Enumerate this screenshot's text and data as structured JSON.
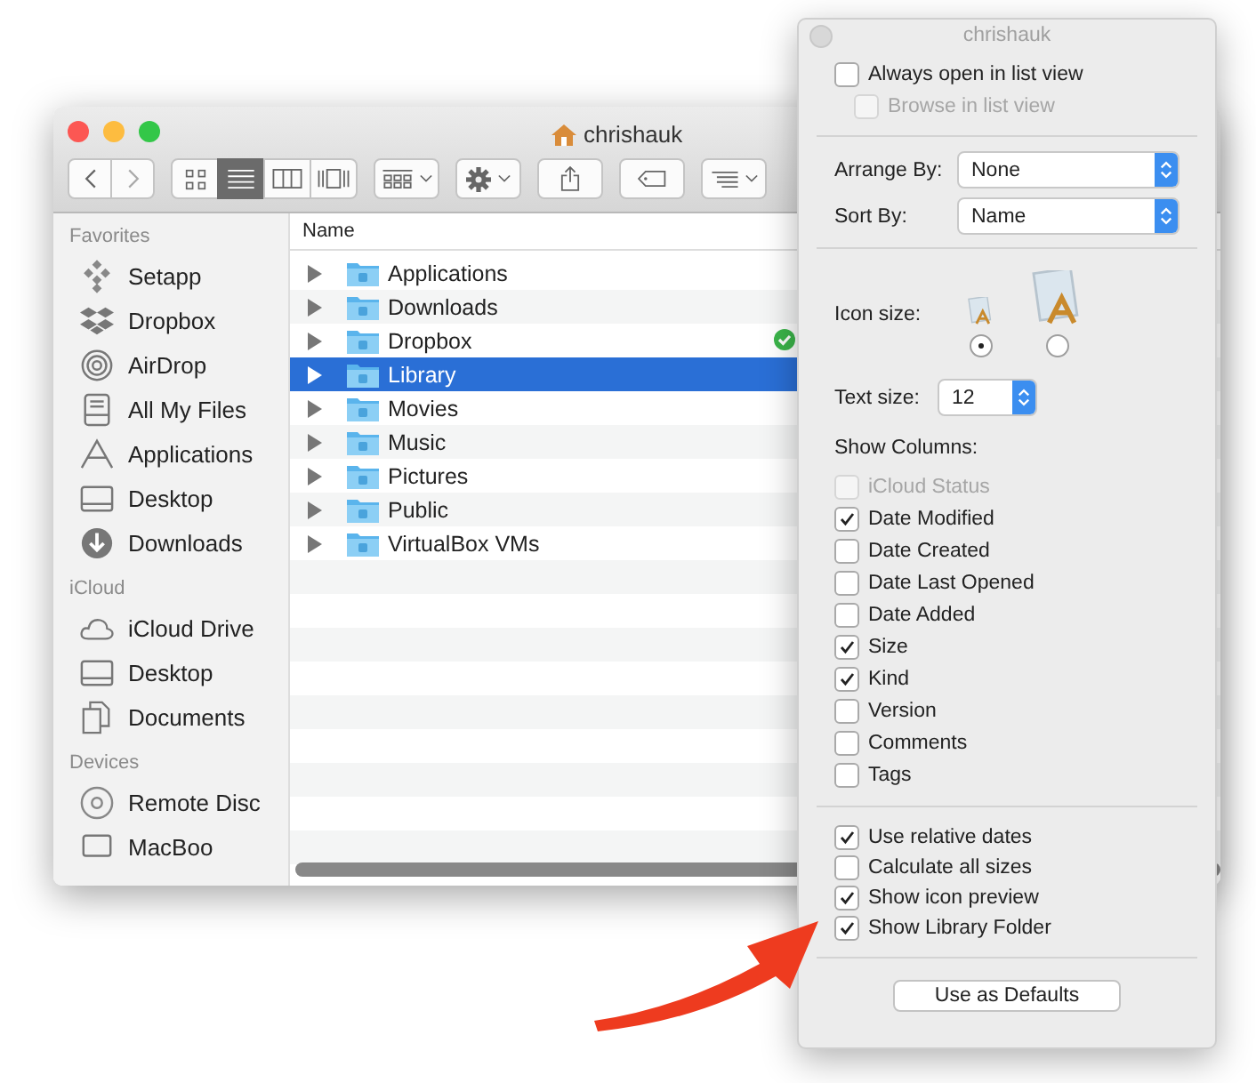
{
  "finder": {
    "title": "chrishauk",
    "toolbar": {
      "view_modes": [
        {
          "selected": false
        },
        {
          "selected": true
        },
        {
          "selected": false
        },
        {
          "selected": false
        }
      ]
    },
    "sidebar": [
      {
        "heading": "Favorites",
        "items": [
          {
            "label": "Setapp"
          },
          {
            "label": "Dropbox"
          },
          {
            "label": "AirDrop"
          },
          {
            "label": "All My Files"
          },
          {
            "label": "Applications"
          },
          {
            "label": "Desktop"
          },
          {
            "label": "Downloads"
          }
        ]
      },
      {
        "heading": "iCloud",
        "items": [
          {
            "label": "iCloud Drive"
          },
          {
            "label": "Desktop"
          },
          {
            "label": "Documents"
          }
        ]
      },
      {
        "heading": "Devices",
        "items": [
          {
            "label": "Remote Disc"
          },
          {
            "label": "MacBoo"
          }
        ]
      }
    ],
    "columns": [
      "Name"
    ],
    "rows": [
      {
        "name": "Applications",
        "selected": false,
        "synced": false
      },
      {
        "name": "Downloads",
        "selected": false,
        "synced": false
      },
      {
        "name": "Dropbox",
        "selected": false,
        "synced": true
      },
      {
        "name": "Library",
        "selected": true,
        "synced": false
      },
      {
        "name": "Movies",
        "selected": false,
        "synced": false
      },
      {
        "name": "Music",
        "selected": false,
        "synced": false
      },
      {
        "name": "Pictures",
        "selected": false,
        "synced": false
      },
      {
        "name": "Public",
        "selected": false,
        "synced": false
      },
      {
        "name": "VirtualBox VMs",
        "selected": false,
        "synced": false
      }
    ]
  },
  "view_options": {
    "title": "chrishauk",
    "open_options": [
      {
        "label": "Always open in list view",
        "checked": false,
        "disabled": false
      },
      {
        "label": "Browse in list view",
        "checked": false,
        "disabled": true
      }
    ],
    "popups": [
      {
        "label": "Arrange By:",
        "value": "None"
      },
      {
        "label": "Sort By:",
        "value": "Name"
      }
    ],
    "icon_size": {
      "label": "Icon size:",
      "options": [
        {
          "selected": true
        },
        {
          "selected": false
        }
      ]
    },
    "text_size": {
      "label": "Text size:",
      "value": "12"
    },
    "show_columns": {
      "heading": "Show Columns:",
      "items": [
        {
          "label": "iCloud Status",
          "checked": false,
          "disabled": true
        },
        {
          "label": "Date Modified",
          "checked": true,
          "disabled": false
        },
        {
          "label": "Date Created",
          "checked": false,
          "disabled": false
        },
        {
          "label": "Date Last Opened",
          "checked": false,
          "disabled": false
        },
        {
          "label": "Date Added",
          "checked": false,
          "disabled": false
        },
        {
          "label": "Size",
          "checked": true,
          "disabled": false
        },
        {
          "label": "Kind",
          "checked": true,
          "disabled": false
        },
        {
          "label": "Version",
          "checked": false,
          "disabled": false
        },
        {
          "label": "Comments",
          "checked": false,
          "disabled": false
        },
        {
          "label": "Tags",
          "checked": false,
          "disabled": false
        }
      ]
    },
    "options": [
      {
        "label": "Use relative dates",
        "checked": true
      },
      {
        "label": "Calculate all sizes",
        "checked": false
      },
      {
        "label": "Show icon preview",
        "checked": true
      },
      {
        "label": "Show Library Folder",
        "checked": true
      }
    ],
    "button": "Use as Defaults"
  }
}
